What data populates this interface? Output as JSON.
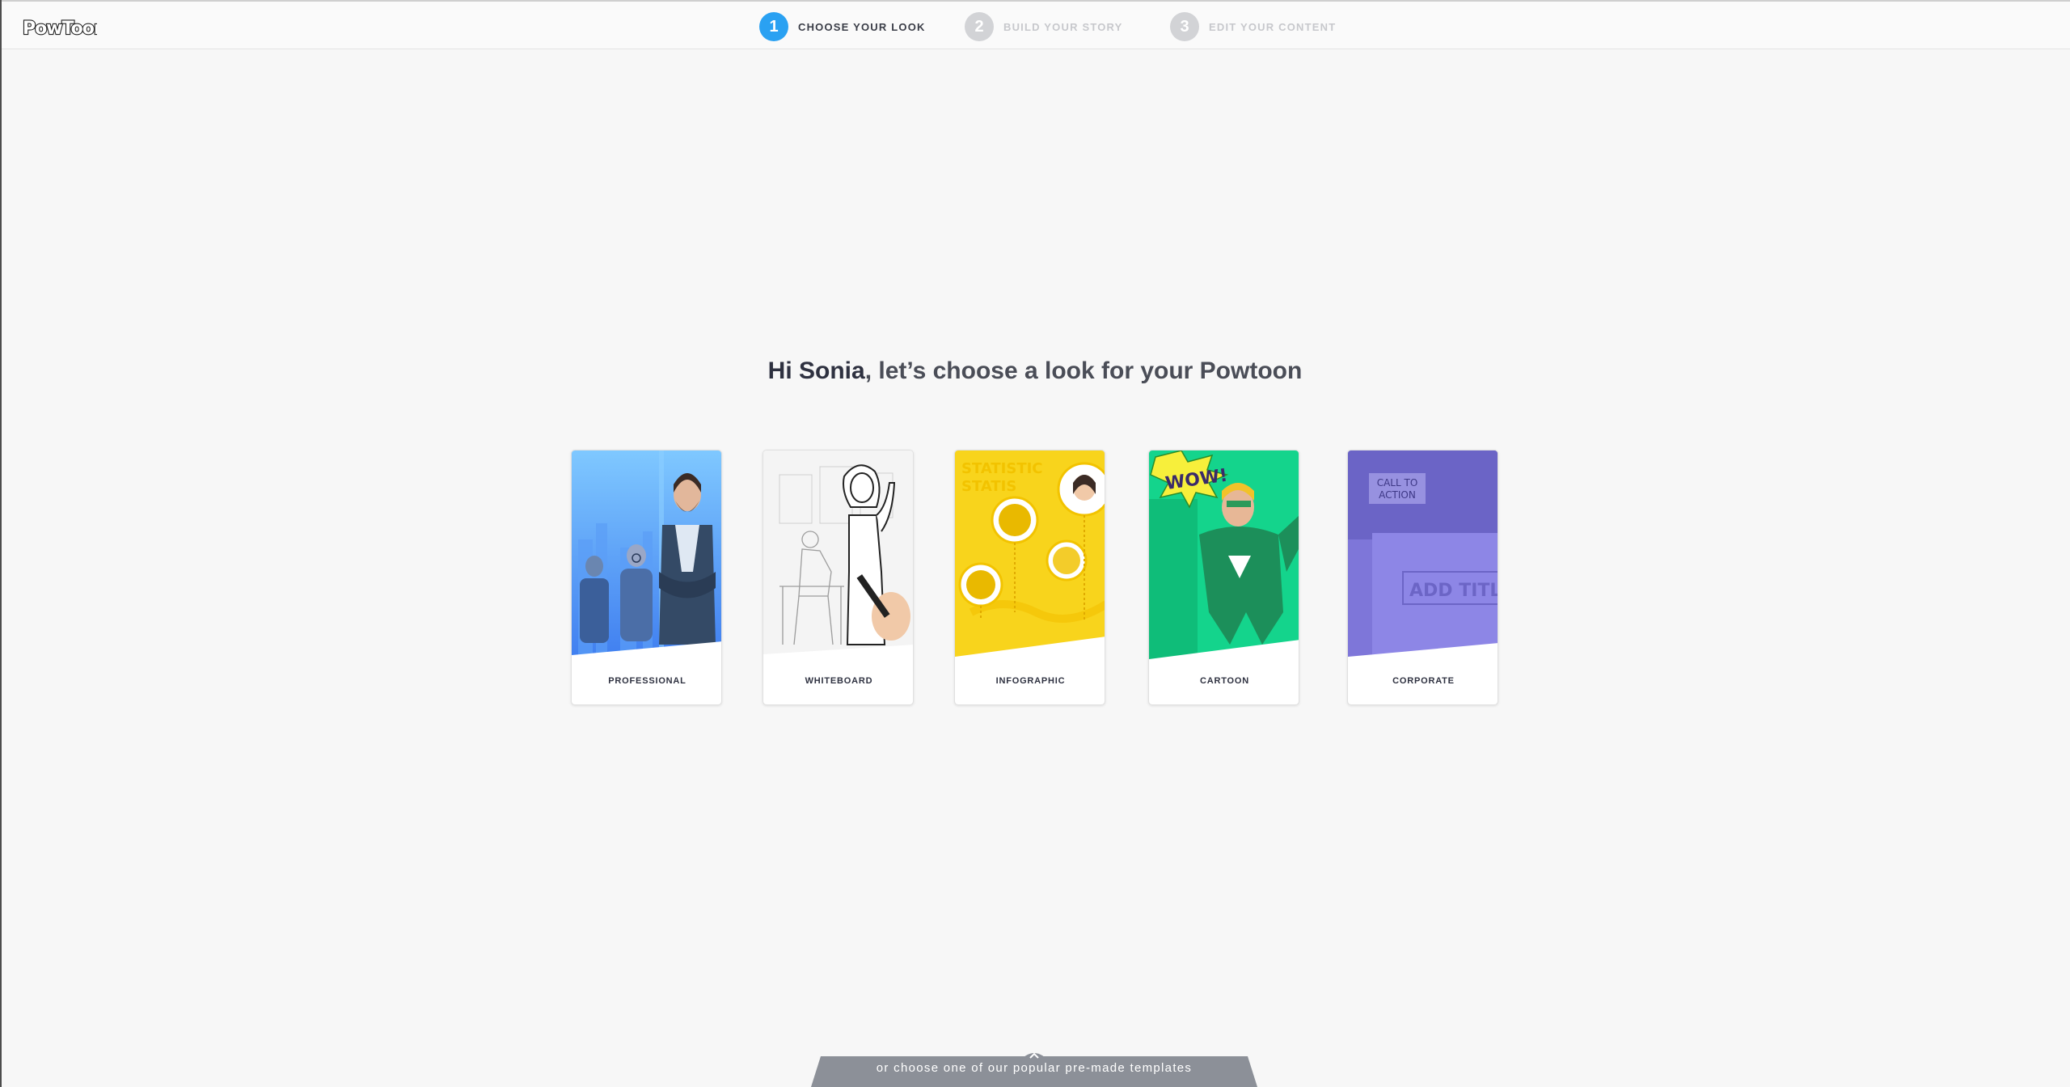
{
  "app": {
    "logo_text": "PowToon"
  },
  "steps": [
    {
      "num": "1",
      "label": "CHOOSE YOUR LOOK",
      "active": true
    },
    {
      "num": "2",
      "label": "BUILD YOUR STORY",
      "active": false
    },
    {
      "num": "3",
      "label": "EDIT YOUR CONTENT",
      "active": false
    }
  ],
  "headline": {
    "name": "Hi Sonia",
    "rest": ", let’s choose a look for your Powtoon"
  },
  "styles": [
    {
      "label": "PROFESSIONAL"
    },
    {
      "label": "WHITEBOARD"
    },
    {
      "label": "INFOGRAPHIC",
      "art_text": [
        "STATISTIC",
        "STATIS"
      ]
    },
    {
      "label": "CARTOON",
      "art_text": [
        "WOW!"
      ]
    },
    {
      "label": "CORPORATE",
      "art_text": [
        "CALL TO",
        "ACTION",
        "ADD TITL"
      ]
    }
  ],
  "footer": {
    "templates_text": "or choose one of our popular pre-made templates"
  },
  "colors": {
    "accent": "#2aa1f2",
    "tab_gray": "#8c9098",
    "professional": "#4da9f5",
    "infographic": "#f6d21a",
    "cartoon": "#12d38c",
    "corporate": "#7d73d8"
  }
}
